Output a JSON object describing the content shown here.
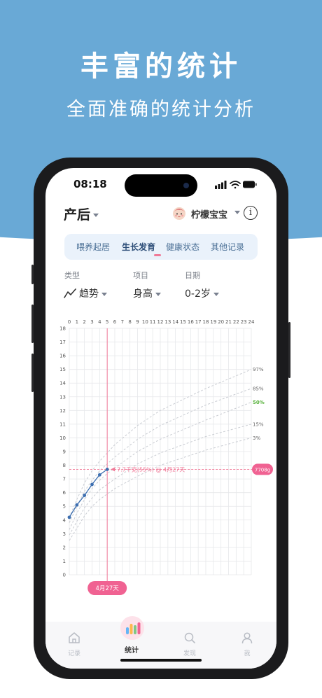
{
  "promo": {
    "headline": "丰富的统计",
    "subheadline": "全面准确的统计分析"
  },
  "status_bar": {
    "time": "08:18"
  },
  "header": {
    "stage": "产后",
    "baby_name": "柠檬宝宝"
  },
  "tabs": [
    {
      "label": "喂养起居",
      "active": false
    },
    {
      "label": "生长发育",
      "active": true
    },
    {
      "label": "健康状态",
      "active": false
    },
    {
      "label": "其他记录",
      "active": false
    }
  ],
  "filters": {
    "type_label": "类型",
    "type_value": "趋势",
    "item_label": "项目",
    "item_value": "身高",
    "date_label": "日期",
    "date_value": "0-2岁"
  },
  "chart_data": {
    "type": "line",
    "x_ticks": [
      "0",
      "1",
      "2",
      "3",
      "4",
      "5",
      "6",
      "7",
      "8",
      "9",
      "10",
      "11",
      "12",
      "13",
      "14",
      "15",
      "16",
      "17",
      "18",
      "19",
      "20",
      "21",
      "22",
      "23",
      "24"
    ],
    "y_ticks": [
      "0",
      "1",
      "2",
      "3",
      "4",
      "5",
      "6",
      "7",
      "8",
      "9",
      "10",
      "11",
      "12",
      "13",
      "14",
      "15",
      "16",
      "17",
      "18"
    ],
    "xlim": [
      0,
      24
    ],
    "ylim": [
      0,
      18
    ],
    "grid": true,
    "percentiles": [
      {
        "name": "97%",
        "values": [
          [
            0,
            4.2
          ],
          [
            1,
            5.5
          ],
          [
            2,
            6.7
          ],
          [
            3,
            7.6
          ],
          [
            4,
            8.3
          ],
          [
            5,
            8.9
          ],
          [
            6,
            9.5
          ],
          [
            9,
            10.9
          ],
          [
            12,
            12.0
          ],
          [
            18,
            13.6
          ],
          [
            24,
            15.0
          ]
        ]
      },
      {
        "name": "85%",
        "values": [
          [
            0,
            3.8
          ],
          [
            1,
            5.0
          ],
          [
            2,
            6.1
          ],
          [
            3,
            6.9
          ],
          [
            4,
            7.6
          ],
          [
            5,
            8.1
          ],
          [
            6,
            8.6
          ],
          [
            9,
            9.9
          ],
          [
            12,
            10.9
          ],
          [
            18,
            12.4
          ],
          [
            24,
            13.6
          ]
        ]
      },
      {
        "name": "50%",
        "values": [
          [
            0,
            3.3
          ],
          [
            1,
            4.5
          ],
          [
            2,
            5.5
          ],
          [
            3,
            6.3
          ],
          [
            4,
            6.9
          ],
          [
            5,
            7.4
          ],
          [
            6,
            7.8
          ],
          [
            9,
            9.0
          ],
          [
            12,
            9.9
          ],
          [
            18,
            11.3
          ],
          [
            24,
            12.6
          ]
        ]
      },
      {
        "name": "15%",
        "values": [
          [
            0,
            2.9
          ],
          [
            1,
            3.9
          ],
          [
            2,
            4.9
          ],
          [
            3,
            5.6
          ],
          [
            4,
            6.2
          ],
          [
            5,
            6.6
          ],
          [
            6,
            7.0
          ],
          [
            9,
            8.1
          ],
          [
            12,
            8.9
          ],
          [
            18,
            10.1
          ],
          [
            24,
            11.0
          ]
        ]
      },
      {
        "name": "3%",
        "values": [
          [
            0,
            2.5
          ],
          [
            1,
            3.4
          ],
          [
            2,
            4.3
          ],
          [
            3,
            5.0
          ],
          [
            4,
            5.5
          ],
          [
            5,
            5.9
          ],
          [
            6,
            6.3
          ],
          [
            9,
            7.2
          ],
          [
            12,
            8.0
          ],
          [
            18,
            9.1
          ],
          [
            24,
            10.0
          ]
        ]
      }
    ],
    "series": [
      {
        "values": [
          [
            0,
            4.2
          ],
          [
            1,
            5.1
          ],
          [
            2,
            5.8
          ],
          [
            3,
            6.6
          ],
          [
            4,
            7.3
          ],
          [
            5,
            7.7
          ]
        ]
      }
    ],
    "marker": {
      "x": 5,
      "y": 7.7,
      "annotation": "7.7千克(55%) @ 4月27天",
      "value_badge": "7708g",
      "date_badge": "4月27天"
    },
    "colors": {
      "series": "#3d6fb0",
      "marker_line": "#f07a98",
      "badge": "#f06292",
      "p50": "#57b23b",
      "percentile": "#c9ccd2"
    }
  },
  "tabbar": {
    "items": [
      {
        "label": "记录",
        "icon": "home-icon"
      },
      {
        "label": "统计",
        "icon": "bar-chart-icon",
        "active": true
      },
      {
        "label": "发现",
        "icon": "search-icon"
      },
      {
        "label": "我",
        "icon": "user-icon"
      }
    ]
  }
}
